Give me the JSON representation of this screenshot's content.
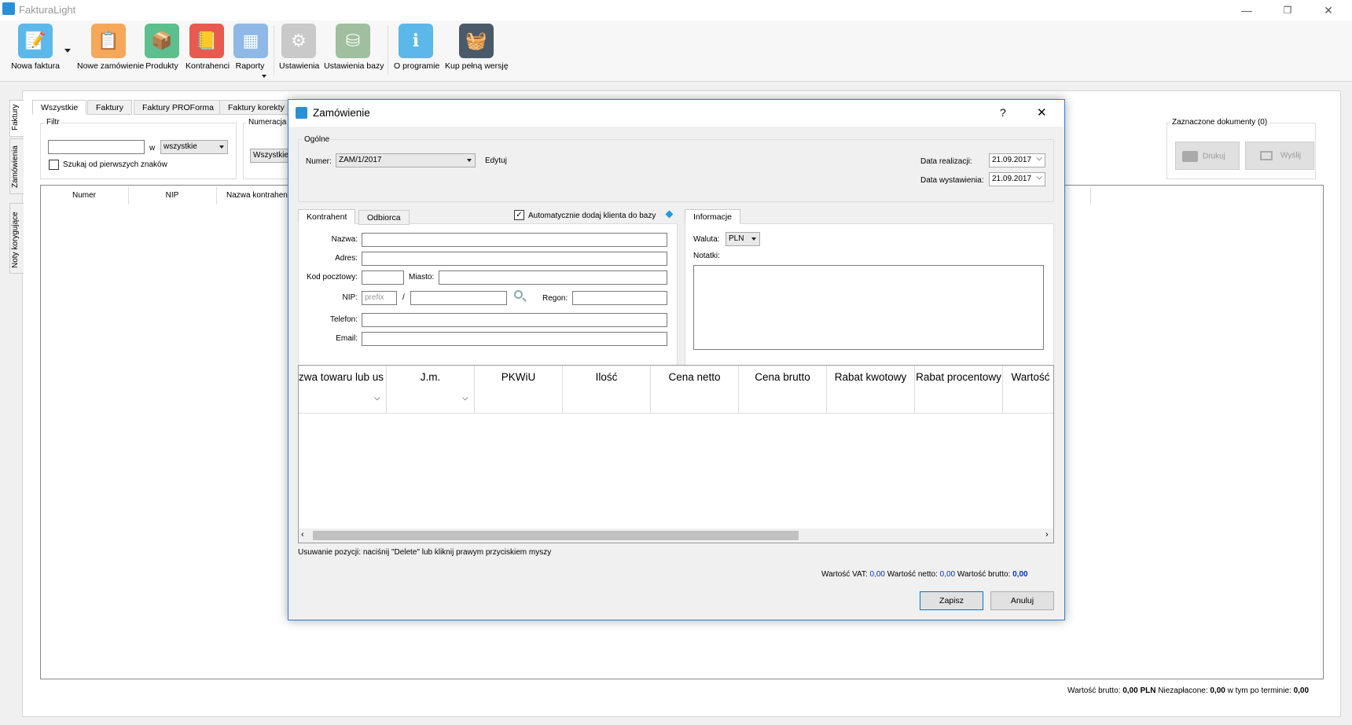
{
  "window": {
    "title": "FakturaLight",
    "minimize": "—",
    "restore": "❐",
    "close": "✕"
  },
  "ribbon": [
    {
      "key": "new_invoice",
      "label": "Nowa faktura",
      "icon": "invoice-icon",
      "color": "#5bb8e8",
      "glyph": "📝"
    },
    {
      "key": "new_order",
      "label": "Nowe zamówienie",
      "icon": "order-icon",
      "color": "#f5a85a",
      "glyph": "📋"
    },
    {
      "key": "products",
      "label": "Produkty",
      "icon": "products-icon",
      "color": "#5cbf8e",
      "glyph": "📦"
    },
    {
      "key": "contractors",
      "label": "Kontrahenci",
      "icon": "contractors-icon",
      "color": "#e8594f",
      "glyph": "📒"
    },
    {
      "key": "reports",
      "label": "Raporty",
      "icon": "reports-icon",
      "color": "#8fb8e6",
      "glyph": "▦"
    },
    {
      "key": "settings",
      "label": "Ustawienia",
      "icon": "settings-icon",
      "color": "#c9c9c9",
      "glyph": "⚙"
    },
    {
      "key": "db_settings",
      "label": "Ustawienia bazy",
      "icon": "database-icon",
      "color": "#9fbf9f",
      "glyph": "⛁"
    },
    {
      "key": "about",
      "label": "O programie",
      "icon": "info-icon",
      "color": "#5bb8e8",
      "glyph": "i"
    },
    {
      "key": "buy",
      "label": "Kup pełną wersję",
      "icon": "basket-icon",
      "color": "#4a5a6a",
      "glyph": "🧺"
    }
  ],
  "side_tabs": [
    "Faktury",
    "Zamówienia",
    "Noty korygujące"
  ],
  "doc_tabs": [
    "Wszystkie",
    "Faktury",
    "Faktury PROForma",
    "Faktury korekty"
  ],
  "filter": {
    "legend": "Filtr",
    "in_label": "w",
    "scope_value": "wszystkie",
    "prefix_search_label": "Szukaj od pierwszych znaków"
  },
  "numbering": {
    "legend": "Numeracja",
    "value": "Wszystkie"
  },
  "list_columns": [
    "Numer",
    "NIP",
    "Nazwa kontrahent"
  ],
  "selected_docs": {
    "legend": "Zaznaczone dokumenty (0)",
    "print": "Drukuj",
    "send": "Wyślij"
  },
  "footer": {
    "gross_label": "Wartość brutto:",
    "gross_value": "0,00",
    "currency": "PLN",
    "unpaid_label": "Niezapłacone:",
    "unpaid_value": "0,00",
    "overdue_label": "w tym po terminie:",
    "overdue_value": "0,00"
  },
  "dialog": {
    "title": "Zamówienie",
    "help": "?",
    "close": "✕",
    "general": {
      "legend": "Ogólne",
      "number_label": "Numer:",
      "number_value": "ZAM/1/2017",
      "edit_link": "Edytuj",
      "realization_label": "Data realizacji:",
      "realization_value": "21.09.2017",
      "issue_label": "Data wystawienia:",
      "issue_value": "21.09.2017"
    },
    "tabs": [
      "Kontrahent",
      "Odbiorca"
    ],
    "auto_add_label": "Automatycznie dodaj klienta do bazy",
    "contractor": {
      "name_label": "Nazwa:",
      "address_label": "Adres:",
      "postal_label": "Kod pocztowy:",
      "city_label": "Miasto:",
      "nip_label": "NIP:",
      "nip_prefix_placeholder": "prefix",
      "nip_sep": "/",
      "regon_label": "Regon:",
      "phone_label": "Telefon:",
      "email_label": "Email:"
    },
    "info": {
      "tab": "Informacje",
      "currency_label": "Waluta:",
      "currency_value": "PLN",
      "notes_label": "Notatki:"
    },
    "grid_columns": [
      "zwa towaru lub us",
      "J.m.",
      "PKWiU",
      "Ilość",
      "Cena netto",
      "Cena brutto",
      "Rabat kwotowy",
      "Rabat procentowy",
      "Wartość"
    ],
    "hint": "Usuwanie pozycji: naciśnij \"Delete\" lub kliknij prawym przyciskiem myszy",
    "totals": {
      "vat_label": "Wartość VAT:",
      "vat_value": "0,00",
      "net_label": "Wartość netto:",
      "net_value": "0,00",
      "gross_label": "Wartość brutto:",
      "gross_value": "0,00"
    },
    "save": "Zapisz",
    "cancel": "Anuluj"
  }
}
